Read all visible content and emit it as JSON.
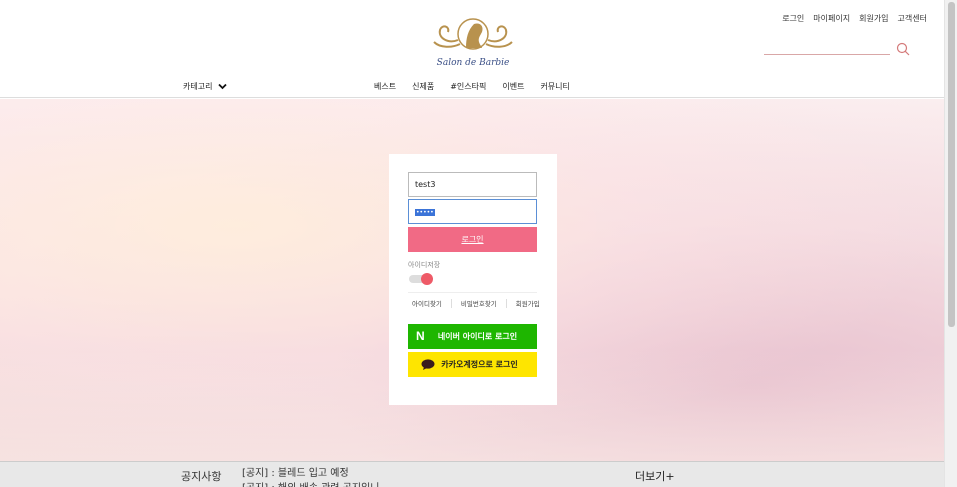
{
  "header": {
    "top_links": [
      "로그인",
      "마이페이지",
      "회원가입",
      "고객센터"
    ],
    "logo_text": "Salon de Barbie",
    "search": {
      "placeholder": "",
      "value": ""
    }
  },
  "nav": {
    "category_label": "카테고리",
    "items": [
      "베스트",
      "신제품",
      "#인스타픽",
      "이벤트",
      "커뮤니티"
    ]
  },
  "login": {
    "id_value": "test3",
    "password_mask": "•••••",
    "login_button": "로그인",
    "save_id_label": "아이디저장",
    "save_id_on": true,
    "links": [
      "아이디찾기",
      "비밀번호찾기",
      "회원가입"
    ],
    "naver_label": "네이버 아이디로 로그인",
    "naver_letter": "N",
    "kakao_label": "카카오계정으로 로그인"
  },
  "notice": {
    "title": "공지사항",
    "items": [
      "[공지] : 블레드 입고 예정",
      "[공지] : 해외 배송 관련 공지입니"
    ],
    "more": "더보기+"
  },
  "colors": {
    "accent_pink": "#f16a85",
    "naver_green": "#1eb600",
    "kakao_yellow": "#fee500",
    "logo_gold": "#b8924e"
  }
}
